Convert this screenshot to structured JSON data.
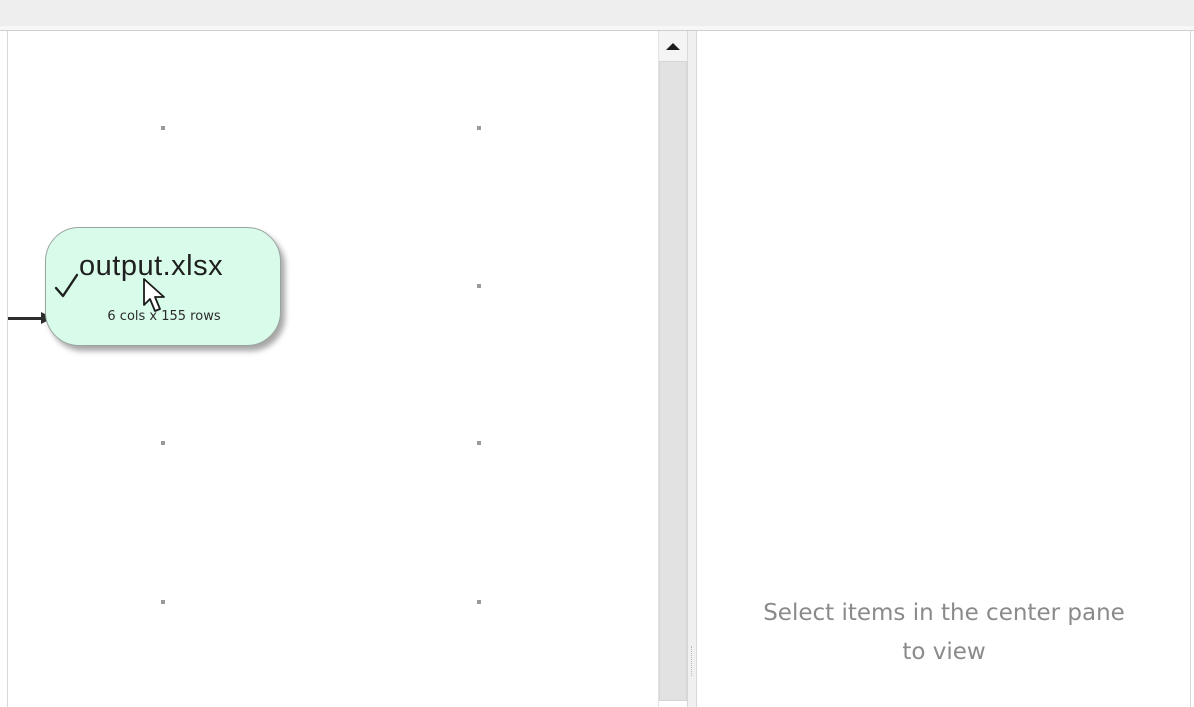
{
  "node": {
    "title": "output.xlsx",
    "subtitle": "6 cols x 155 rows",
    "status_icon": "check-icon",
    "fill_color": "#d8fbea"
  },
  "canvas": {
    "connector_icon": "arrow-right-icon",
    "cursor_icon": "mouse-pointer-icon"
  },
  "scrollbar": {
    "up_icon": "triangle-up-icon"
  },
  "details_pane": {
    "placeholder_line1": "Select items in the center pane",
    "placeholder_line2": "to view"
  }
}
